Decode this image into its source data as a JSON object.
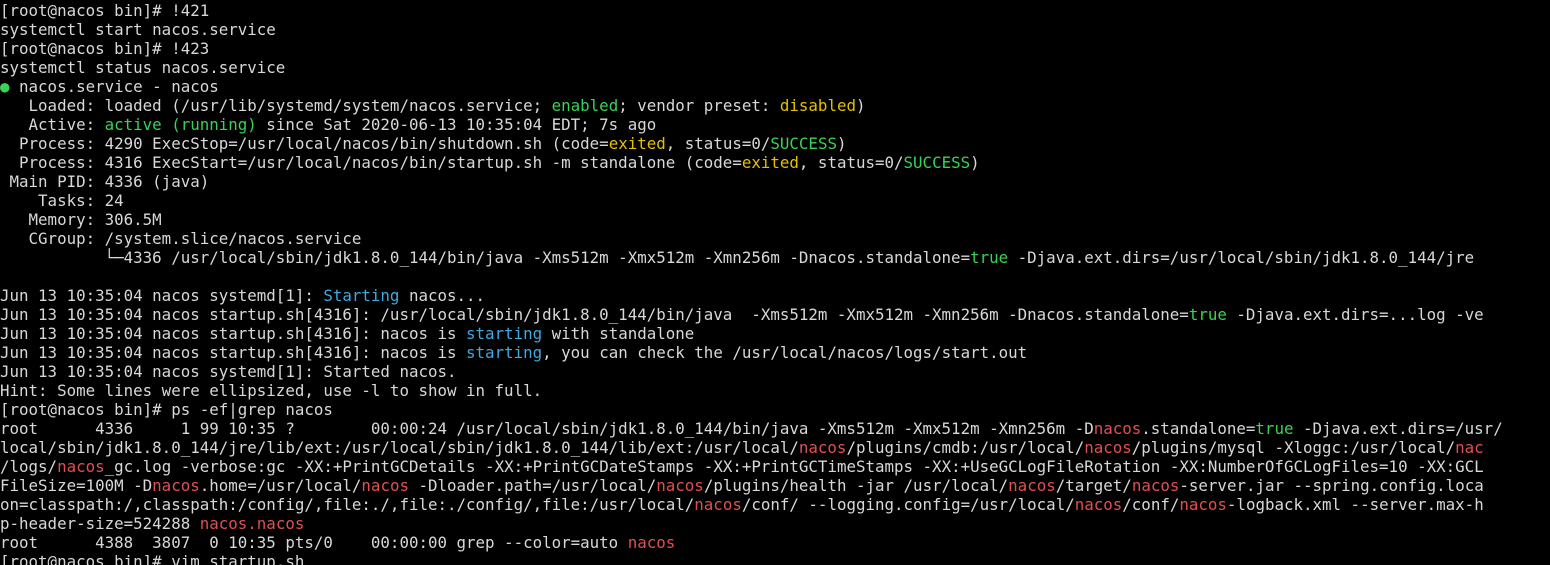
{
  "window": {
    "type": "terminal"
  },
  "colors": {
    "background": "#000000",
    "foreground": "#d8d8d8",
    "green": "#39d353",
    "cyan": "#3fa9e0",
    "yellow": "#e5c000",
    "red": "#e05050"
  },
  "lines": [
    [
      {
        "t": "[root@nacos bin]# !421"
      }
    ],
    [
      {
        "t": "systemctl start nacos.service"
      }
    ],
    [
      {
        "t": "[root@nacos bin]# !423"
      }
    ],
    [
      {
        "t": "systemctl status nacos.service"
      }
    ],
    [
      {
        "t": "●",
        "c": "dot"
      },
      {
        "t": " nacos.service - nacos"
      }
    ],
    [
      {
        "t": "   Loaded: loaded (/usr/lib/systemd/system/nacos.service; "
      },
      {
        "t": "enabled",
        "c": "green"
      },
      {
        "t": "; vendor preset: "
      },
      {
        "t": "disabled",
        "c": "yellow"
      },
      {
        "t": ")"
      }
    ],
    [
      {
        "t": "   Active: "
      },
      {
        "t": "active (running)",
        "c": "green"
      },
      {
        "t": " since Sat 2020-06-13 10:35:04 EDT; 7s ago"
      }
    ],
    [
      {
        "t": "  Process: 4290 ExecStop=/usr/local/nacos/bin/shutdown.sh (code="
      },
      {
        "t": "exited",
        "c": "yellow"
      },
      {
        "t": ", status=0/"
      },
      {
        "t": "SUCCESS",
        "c": "green"
      },
      {
        "t": ")"
      }
    ],
    [
      {
        "t": "  Process: 4316 ExecStart=/usr/local/nacos/bin/startup.sh -m standalone (code="
      },
      {
        "t": "exited",
        "c": "yellow"
      },
      {
        "t": ", status=0/"
      },
      {
        "t": "SUCCESS",
        "c": "green"
      },
      {
        "t": ")"
      }
    ],
    [
      {
        "t": " Main PID: 4336 (java)"
      }
    ],
    [
      {
        "t": "    Tasks: 24"
      }
    ],
    [
      {
        "t": "   Memory: 306.5M"
      }
    ],
    [
      {
        "t": "   CGroup: /system.slice/nacos.service"
      }
    ],
    [
      {
        "t": "           └─4336 /usr/local/sbin/jdk1.8.0_144/bin/java -Xms512m -Xmx512m -Xmn256m -Dnacos.standalone="
      },
      {
        "t": "true",
        "c": "green"
      },
      {
        "t": " -Djava.ext.dirs=/usr/local/sbin/jdk1.8.0_144/jre"
      }
    ],
    [
      {
        "t": ""
      }
    ],
    [
      {
        "t": "Jun 13 10:35:04 nacos systemd[1]: "
      },
      {
        "t": "Starting",
        "c": "cyan"
      },
      {
        "t": " nacos..."
      }
    ],
    [
      {
        "t": "Jun 13 10:35:04 nacos startup.sh[4316]: /usr/local/sbin/jdk1.8.0_144/bin/java  -Xms512m -Xmx512m -Xmn256m -Dnacos.standalone="
      },
      {
        "t": "true",
        "c": "green"
      },
      {
        "t": " -Djava.ext.dirs=...log -ve"
      }
    ],
    [
      {
        "t": "Jun 13 10:35:04 nacos startup.sh[4316]: nacos is "
      },
      {
        "t": "starting",
        "c": "cyan"
      },
      {
        "t": " with standalone"
      }
    ],
    [
      {
        "t": "Jun 13 10:35:04 nacos startup.sh[4316]: nacos is "
      },
      {
        "t": "starting",
        "c": "cyan"
      },
      {
        "t": ", you can check the /usr/local/nacos/logs/start.out"
      }
    ],
    [
      {
        "t": "Jun 13 10:35:04 nacos systemd[1]: Started nacos."
      }
    ],
    [
      {
        "t": "Hint: Some lines were ellipsized, use -l to show in full."
      }
    ],
    [
      {
        "t": "[root@nacos bin]# ps -ef|grep nacos"
      }
    ],
    [
      {
        "t": "root      4336     1 99 10:35 ?        00:00:24 /usr/local/sbin/jdk1.8.0_144/bin/java -Xms512m -Xmx512m -Xmn256m -D"
      },
      {
        "t": "nacos",
        "c": "red"
      },
      {
        "t": ".standalone="
      },
      {
        "t": "true",
        "c": "green"
      },
      {
        "t": " -Djava.ext.dirs=/usr/"
      }
    ],
    [
      {
        "t": "local/sbin/jdk1.8.0_144/jre/lib/ext:/usr/local/sbin/jdk1.8.0_144/lib/ext:/usr/local/"
      },
      {
        "t": "nacos",
        "c": "red"
      },
      {
        "t": "/plugins/cmdb:/usr/local/"
      },
      {
        "t": "nacos",
        "c": "red"
      },
      {
        "t": "/plugins/mysql -Xloggc:/usr/local/"
      },
      {
        "t": "nac",
        "c": "red"
      }
    ],
    [
      {
        "t": "/logs/"
      },
      {
        "t": "nacos",
        "c": "red"
      },
      {
        "t": "_gc.log -verbose:gc -XX:+PrintGCDetails -XX:+PrintGCDateStamps -XX:+PrintGCTimeStamps -XX:+UseGCLogFileRotation -XX:NumberOfGCLogFiles=10 -XX:GCL"
      }
    ],
    [
      {
        "t": "FileSize=100M -D"
      },
      {
        "t": "nacos",
        "c": "red"
      },
      {
        "t": ".home=/usr/local/"
      },
      {
        "t": "nacos",
        "c": "red"
      },
      {
        "t": " -Dloader.path=/usr/local/"
      },
      {
        "t": "nacos",
        "c": "red"
      },
      {
        "t": "/plugins/health -jar /usr/local/"
      },
      {
        "t": "nacos",
        "c": "red"
      },
      {
        "t": "/target/"
      },
      {
        "t": "nacos",
        "c": "red"
      },
      {
        "t": "-server.jar --spring.config.loca"
      }
    ],
    [
      {
        "t": "on=classpath:/,classpath:/config/,file:./,file:./config/,file:/usr/local/"
      },
      {
        "t": "nacos",
        "c": "red"
      },
      {
        "t": "/conf/ --logging.config=/usr/local/"
      },
      {
        "t": "nacos",
        "c": "red"
      },
      {
        "t": "/conf/"
      },
      {
        "t": "nacos",
        "c": "red"
      },
      {
        "t": "-logback.xml --server.max-h"
      }
    ],
    [
      {
        "t": "p-header-size=524288 "
      },
      {
        "t": "nacos.nacos",
        "c": "red"
      }
    ],
    [
      {
        "t": "root      4388  3807  0 10:35 pts/0    00:00:00 grep --color=auto "
      },
      {
        "t": "nacos",
        "c": "red"
      }
    ],
    [
      {
        "t": "[root@nacos bin]# vim startup.sh"
      }
    ]
  ]
}
